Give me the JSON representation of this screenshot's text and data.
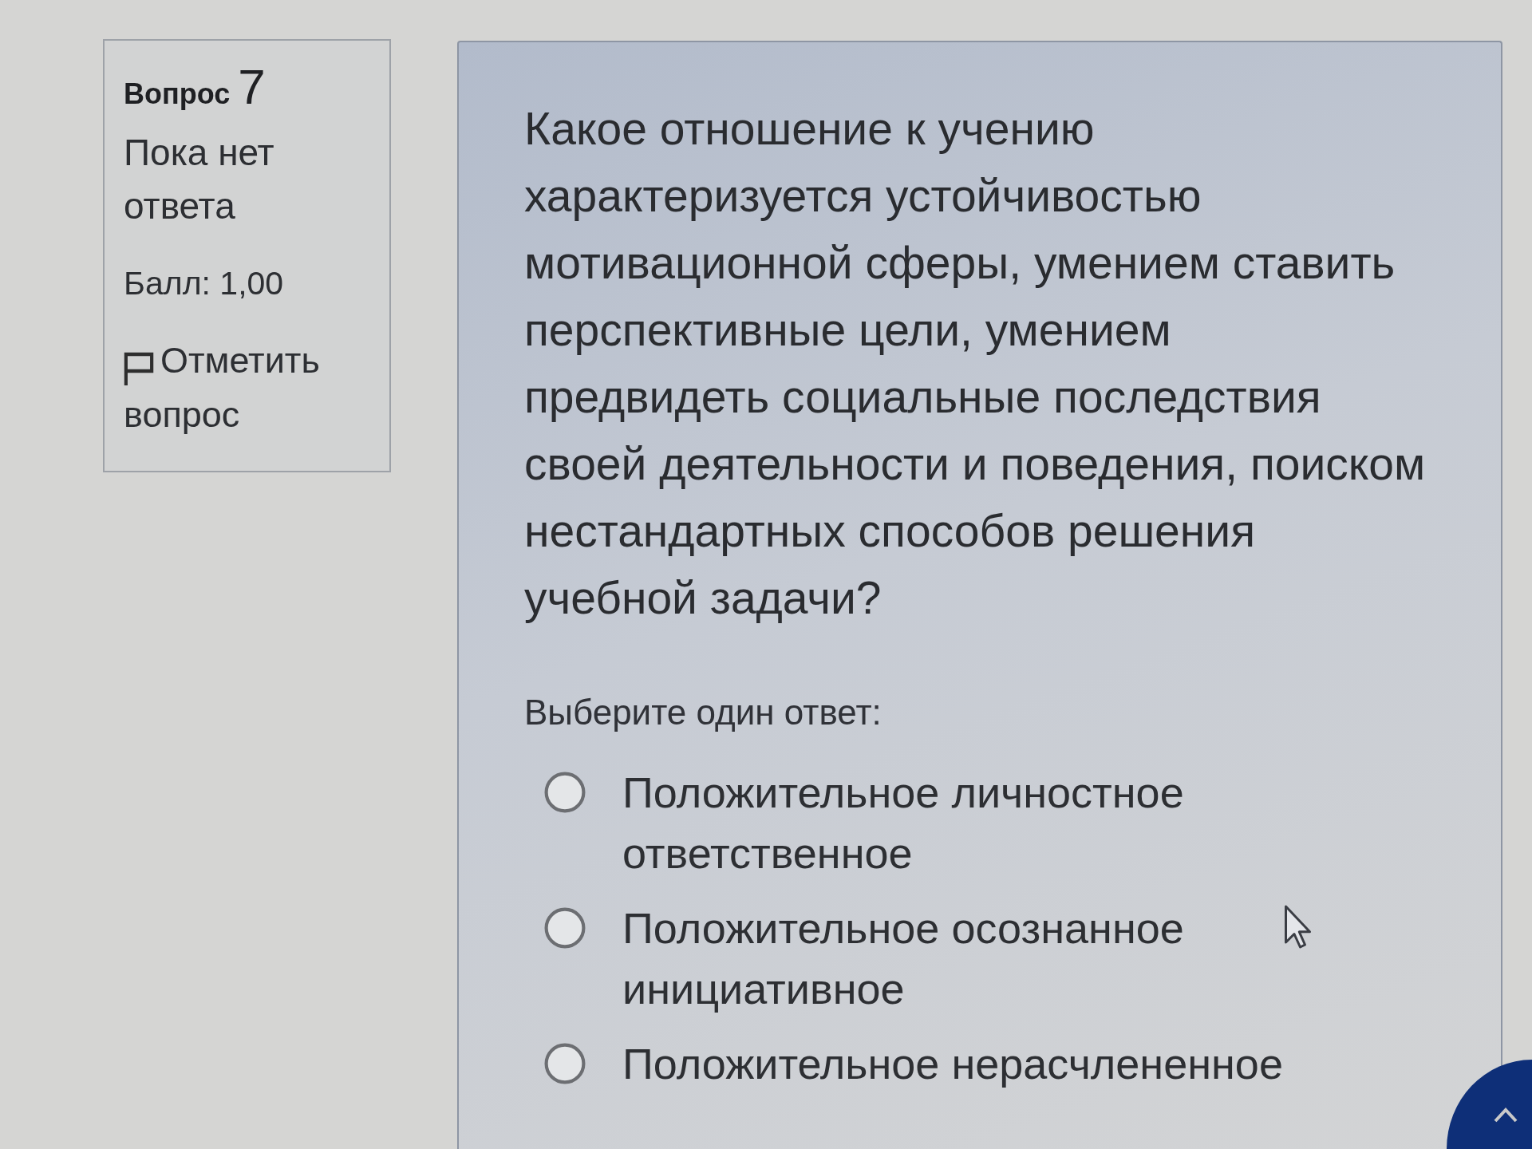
{
  "question_info": {
    "label": "Вопрос",
    "number": "7",
    "status": "Пока нет ответа",
    "score": "Балл: 1,00",
    "flag_link": "Отметить вопрос",
    "flagged": false
  },
  "question": {
    "text": "Какое отношение к учению характеризуется устойчивостью мотивационной сферы, умением ставить перспективные цели, умением предвидеть социальные последствия своей деятельности и поведения, поиском нестандартных способов решения учебной задачи?",
    "prompt": "Выберите один ответ:",
    "answers": [
      {
        "label": "Положительное личностное ответственное",
        "selected": false
      },
      {
        "label": "Положительное осознанное инициативное",
        "selected": false
      },
      {
        "label": "Положительное нерасчлененное",
        "selected": false
      }
    ]
  }
}
